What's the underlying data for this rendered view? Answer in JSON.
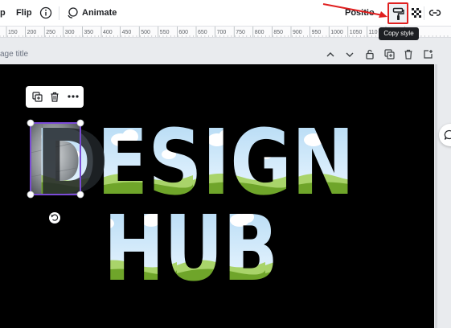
{
  "toolbar": {
    "partial_left_label": "p",
    "flip_label": "Flip",
    "animate_label": "Animate",
    "position_label": "Positio"
  },
  "tooltip": {
    "copy_style": "Copy style"
  },
  "ruler": {
    "ticks": [
      "150",
      "200",
      "250",
      "300",
      "350",
      "400",
      "450",
      "500",
      "550",
      "600",
      "650",
      "700",
      "750",
      "800",
      "850",
      "900",
      "950",
      "1000",
      "1050",
      "110",
      "1250",
      "13"
    ]
  },
  "page": {
    "title": "age title"
  },
  "design": {
    "line1": "DESIGN",
    "line2": "HUB"
  },
  "colors": {
    "highlight": "#e02020",
    "selection": "#7b4bd6",
    "sky": "#cfe6f7",
    "grass": "#7fb030"
  }
}
